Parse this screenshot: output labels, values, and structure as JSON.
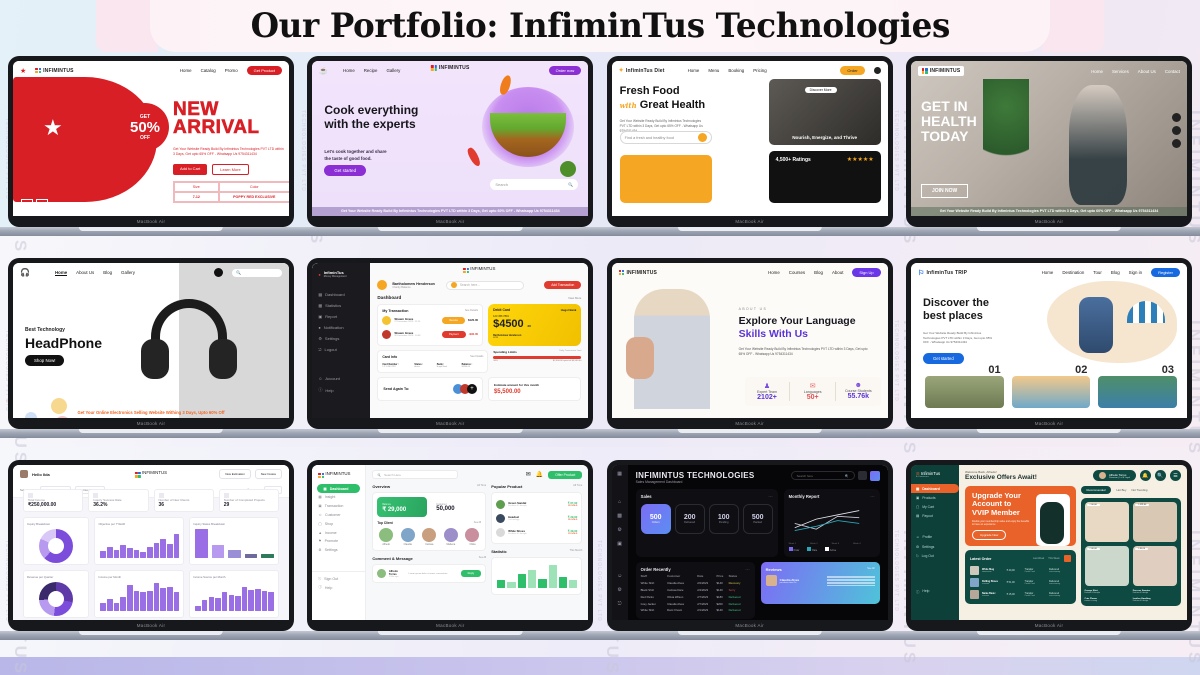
{
  "page": {
    "title": "Our Portfolio: InfiminTus Technologies",
    "watermark": "INFIMINTUS",
    "watermark_sub": "TECHNOLOGIES PVT LTD",
    "brand": "InfiminTus",
    "accent_pink": "#fae6ef",
    "laptop_label": "MacBook Air"
  },
  "mockups": [
    {
      "id": "shoe-store",
      "brand": "INFIMINTUS",
      "nav": [
        "Home",
        "Catalog",
        "Promo"
      ],
      "cta": "Get Product",
      "badge_pre": "GET",
      "badge_value": "50%",
      "badge_post": "OFF",
      "headline_1": "NEW",
      "headline_2": "ARRIVAL",
      "copy": "Get Your Website Ready Build By Infimintus Technologies PVT LTD within 3 Days, Get upto 65% OFF - Whatsapp Us 9754311434",
      "btn_primary": "Add to Cart",
      "btn_secondary": "Learn More",
      "table_headers": [
        "Size",
        "Color"
      ],
      "table_values": [
        "7-12",
        "POPPY RED EXCLUSIVE"
      ],
      "accent": "#d81f26"
    },
    {
      "id": "cooking-site",
      "brand": "INFIMINTUS",
      "nav": [
        "Home",
        "Recipe",
        "Gallery"
      ],
      "cta": "Order now",
      "headline_1": "Cook everything",
      "headline_2": "with the experts",
      "sub_1": "Let's cook together and share",
      "sub_2": "the taste of good food.",
      "btn_primary": "Get started",
      "search_placeholder": "Search",
      "ribbon": "Get Your Website Ready Build By Infimintus Technologies PVT LTD within 3 Days, Get upto 60% OFF - Whatsapp Us 9754311434",
      "accent": "#8b2fd4"
    },
    {
      "id": "diet-site",
      "brand": "InfiminTus Diet",
      "nav": [
        "Home",
        "Menu",
        "Booking",
        "Pricing"
      ],
      "cta": "Order",
      "headline_1": "Fresh Food",
      "headline_script": "with",
      "headline_2": "Great Health",
      "copy": "Get Your Website Ready Build By Infimintus Technologies PVT LTD within 3 Days, Get upto 65% OFF - Whatsapp Us 9754311434",
      "search_placeholder": "Find a fresh and healthy food",
      "hero_caption": "Nourish, Energize, and Thrive",
      "hero_badge": "Discover More",
      "ratings": "4,500+ Ratings",
      "stars": "★★★★★",
      "accent": "#f5a623"
    },
    {
      "id": "yoga-site",
      "brand": "INFIMINTUS",
      "nav": [
        "Home",
        "Services",
        "About Us",
        "Contact"
      ],
      "headline_1": "GET IN",
      "headline_2": "HEALTH",
      "headline_3": "TODAY",
      "btn_primary": "JOIN NOW",
      "ribbon": "Get Your Website Ready Build By Infimintus Technologies PVT LTD within 3 Days, Get upto 60% OFF - Whatsapp Us 9754311434",
      "accent": "#ffffff"
    },
    {
      "id": "headphone-store",
      "nav": [
        "Home",
        "About Us",
        "Blog",
        "Gallery"
      ],
      "eyebrow": "Best Technology",
      "headline": "HeadPhone",
      "btn_primary": "Shop Now!",
      "ribbon": "Get Your Online Electronics Selling Website Withing 3 Days, Upto 60% Off",
      "accent": "#f26522"
    },
    {
      "id": "bank-dashboard",
      "brand": "InfiminTus",
      "brand_sub": "Money Management",
      "top_brand": "INFIMINTUS",
      "user_name": "Bartholomew Henderson",
      "user_sub": "Charity Balance",
      "search_placeholder": "Search here...",
      "cta": "Add Transaction",
      "page_title": "Dashboard",
      "view_more": "View More",
      "sidebar": [
        "Dashboard",
        "Statistics",
        "Report",
        "Notification",
        "Settings",
        "Logout",
        "Account",
        "Help"
      ],
      "transactions_title": "My Transaction",
      "see_details": "See Details",
      "transactions": [
        {
          "name": "Shawn Grace",
          "date": "27 December 2023 - 11:20",
          "tag": "Receive",
          "amount": "$120.00"
        },
        {
          "name": "Shawn Grace",
          "date": "26 December 2023 - 10:38",
          "tag": "Payment",
          "amount": "-$90.00"
        }
      ],
      "card_title": "Debit Card",
      "card_bank": "Hugol Bank",
      "card_number": "123 456 7891",
      "card_amount": "$4500",
      "card_cents": ".00",
      "card_holder": "Bartholomew Henderson",
      "card_exp": "07/25",
      "card_type": "Card",
      "cardinfo_title": "Card Info",
      "cardinfo_headers": [
        "Card Number :",
        "Status :",
        "Bank :",
        "Balance :"
      ],
      "cardinfo_values": [
        "1 2 3 456 7891",
        "Active",
        "Hugol Bank",
        "$4500.00"
      ],
      "send_again": "Send Again To:",
      "spending_title": "Spending Limits",
      "spending_sub": "Daily Transaction Limit",
      "spending_pct": "58%",
      "spending_detail": "$2,500.00 spent of $4,500.00",
      "estimate_title": "Estimate amount for this month",
      "estimate_value": "$5,500.00",
      "accent": "#ffd60a"
    },
    {
      "id": "language-school",
      "brand": "INFIMINTUS",
      "nav": [
        "Home",
        "Courses",
        "Blog",
        "About"
      ],
      "cta": "Sign Up",
      "eyebrow": "ABOUT US",
      "headline_1": "Explore Your Language",
      "headline_2": "Skills With Us",
      "copy": "Get Your Website Ready Build By Infimintus Technologies PVT LTD within 3 Days, Get upto 65% OFF - Whatsapp Us 9754311434",
      "stats": [
        {
          "label": "Expert Team",
          "value": "2102+"
        },
        {
          "label": "Languages",
          "value": "50+"
        },
        {
          "label": "Course Students",
          "value": "55.76k"
        }
      ],
      "accent": "#5b35d5"
    },
    {
      "id": "travel-site",
      "brand": "InfiminTus TRIP",
      "nav": [
        "Home",
        "Destination",
        "Tour",
        "Blog",
        "Sign in"
      ],
      "cta": "Register",
      "headline_1": "Discover the",
      "headline_2": "best places",
      "copy": "Get Your Website Ready Build By Infimintus Technologies PVT LTD within 3 Days, Get upto 65% OFF - Whatsapp Us 9754311434",
      "btn_primary": "Get started",
      "card_numbers": [
        "01",
        "02",
        "03"
      ],
      "accent": "#1769e0"
    },
    {
      "id": "analytics-dashboard",
      "brand": "INFIMINTUS",
      "greeting": "Hello Ilda",
      "btn_1": "New Estimation",
      "btn_2": "New Invoice",
      "filter_label": "Select period",
      "filter_from": "from Jan 1, 2023",
      "filter_to": "to Dec 31, 2023",
      "search_placeholder": "Search",
      "print": "Print",
      "kpis": [
        {
          "label": "Total Income",
          "value": "₹250,000.00"
        },
        {
          "label": "Inquiry Success Rate",
          "value": "36.2%"
        },
        {
          "label": "Number of New Clients",
          "value": "36"
        },
        {
          "label": "Number of Completed Projects",
          "value": "29"
        }
      ],
      "chart_titles": [
        "Inquiry Breakdown",
        "Objective per TYEAR",
        "Inquiry Status Breakdown",
        "Revenue per Quarter",
        "Income per Month",
        "Income Source per Month"
      ],
      "accent": "#7c4ddb"
    },
    {
      "id": "green-admin",
      "brand": "INFIMINTUS",
      "search_placeholder": "Search Here",
      "cta": "Offer Product",
      "sidebar": [
        "Dashboard",
        "Insight",
        "Transaction",
        "Customer",
        "Shop",
        "Income",
        "Promote",
        "Settings",
        "Sign Out",
        "Help"
      ],
      "overview_title": "Overview",
      "overview_filter": "All Time",
      "balance_label": "Balance",
      "balance_value": "₹ 29,000",
      "customer_label": "Customer",
      "customer_value": "50,000",
      "top_client_title": "Top Client",
      "see_all": "See All",
      "clients": [
        "Alfredo",
        "Claudia",
        "Carissa",
        "Marlena",
        "Olivia"
      ],
      "comment_title": "Comment & Message",
      "comment_user": "Alfredo Torres",
      "comment_time": "1 Min ago",
      "comment_text": "Lorem ipsum dolor sit amet, consectetur",
      "comment_btn": "Reply",
      "popular_title": "Popular Product",
      "popular_filter": "All Time",
      "products": [
        {
          "name": "Green Sandal",
          "cat": "Fashion & Lifestyle",
          "price": "₹ 67,90",
          "sold": "$2 SOLD"
        },
        {
          "name": "Headset",
          "cat": "Technology",
          "price": "₹ 29,90",
          "sold": "$0 SOLD"
        },
        {
          "name": "White Shoes",
          "cat": "Fashion & Lifestyle",
          "price": "₹ 39,90",
          "sold": "$3 SOLD"
        }
      ],
      "statistic_title": "Statistic",
      "statistic_filter": "This Month",
      "accent": "#2fbf6a"
    },
    {
      "id": "sales-dark-dashboard",
      "title": "INFIMINTUS TECHNOLOGIES",
      "subtitle": "Sales Management Dashboard",
      "search_placeholder": "Search here",
      "sales_title": "Sales",
      "stats": [
        {
          "value": "500",
          "label": "Orders"
        },
        {
          "value": "200",
          "label": "Delivered"
        },
        {
          "value": "100",
          "label": "Pending"
        },
        {
          "value": "500",
          "label": "Packed"
        }
      ],
      "order_title": "Order Recently",
      "order_headers": [
        "Stuff",
        "Customer",
        "Date",
        "Price",
        "Status"
      ],
      "orders": [
        {
          "stuff": "White Shirt",
          "customer": "Claudia Alves",
          "date": "2/2/2023",
          "price": "$140",
          "status": "Recovery"
        },
        {
          "stuff": "Black Shirt",
          "customer": "Carissa Dare",
          "date": "2/4/2023",
          "price": "$140",
          "status": "Sorry"
        },
        {
          "stuff": "Red Pants",
          "customer": "Olivia Wilson",
          "date": "2/7/2023",
          "price": "$180",
          "status": "Delivered"
        },
        {
          "stuff": "Grey Jacket",
          "customer": "Claudia Alves",
          "date": "2/7/2023",
          "price": "$200",
          "status": "Delivered"
        },
        {
          "stuff": "White Shirt",
          "customer": "Dani Orvani",
          "date": "2/1/2023",
          "price": "$140",
          "status": "Delivered"
        }
      ],
      "report_title": "Monthly Report",
      "report_legend": [
        "Order",
        "Rate",
        "Active"
      ],
      "report_xticks": [
        "Week 1",
        "Week 2",
        "Week 3",
        "Week 4"
      ],
      "reviews_title": "Reviews",
      "reviews_see_all": "See All",
      "reviewer": "Claudia Alves",
      "reviewer_sub": "purchase item 2x",
      "accent": "#7c6cf5"
    },
    {
      "id": "vvip-shop",
      "brand": "InfiminTus",
      "brand_sub": "E-Commerce",
      "welcome": "Welcome Back, Alfredo!",
      "headline": "Exclusive Offers Await!",
      "user_name": "Alfredo Torres",
      "user_sub": "Premium | Lvl 6 Loyal",
      "sidebar": [
        "Dashboard",
        "Products",
        "My Cart",
        "Payout",
        "Profile",
        "Settings",
        "Log Out",
        "Help"
      ],
      "promo_title_1": "Upgrade Your",
      "promo_title_2": "Account to",
      "promo_title_3": "VVIP Member",
      "promo_copy": "Double your membership value and enjoy the benefits to have an experience",
      "promo_btn": "Upgrade Now",
      "latest_title": "Latest Order",
      "latest_links": [
        "Last Week",
        "This Week"
      ],
      "orders": [
        {
          "name": "White Mug",
          "cat": "Homeware",
          "price": "₹ 40,00",
          "status": "Transfer",
          "sub": "Credit Card",
          "state": "Delivered",
          "state_sub": "Successfully"
        },
        {
          "name": "Rolling Shoes",
          "cat": "Fashion",
          "price": "₹ 51,00",
          "status": "Transfer",
          "sub": "Credit Card",
          "state": "Delivered",
          "state_sub": "Successfully"
        },
        {
          "name": "Nanie Basic",
          "cat": "Fashion",
          "price": "₹ 15,00",
          "status": "Transfer",
          "sub": "Credit Card",
          "state": "Delivered",
          "state_sub": "Successfully"
        }
      ],
      "tabs": [
        "Recommended",
        "Hot Buy",
        "Not Trending"
      ],
      "products": [
        {
          "tag": "# 60,00",
          "name": "Orange Shirt",
          "cat": "Fashion & Lifestyle"
        },
        {
          "tag": "# 429,00",
          "name": "Dresses Sweater",
          "cat": "Fashion & Lifestyle"
        },
        {
          "tag": "# 60,00",
          "name": "Cute Flower",
          "cat": "Flower & Living"
        },
        {
          "tag": "# 40,00",
          "name": "Leather Handbag",
          "cat": "Fashion & Lifestyle"
        }
      ],
      "accent": "#e8622a"
    }
  ]
}
